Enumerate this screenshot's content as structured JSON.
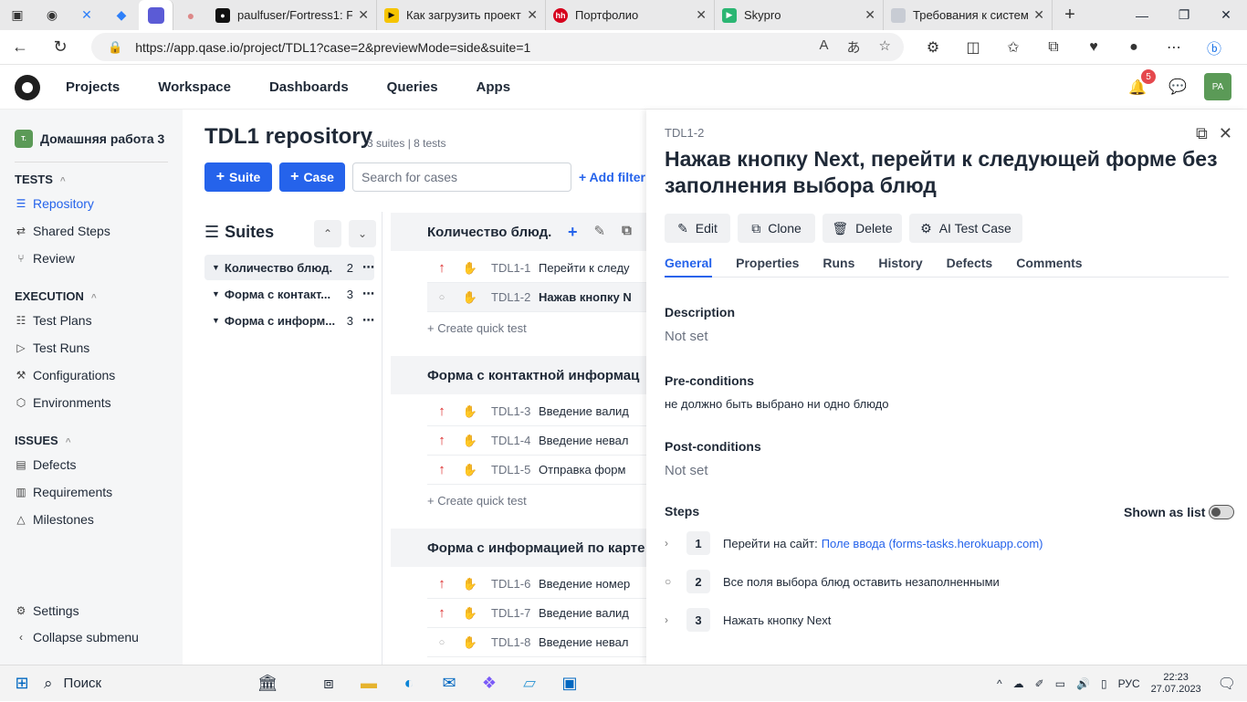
{
  "browser": {
    "tabs": [
      {
        "title": "paulfuser/Fortress1: Fo",
        "color": "#111111"
      },
      {
        "title": "Как загрузить проект",
        "color": "#f5c400"
      },
      {
        "title": "Портфолио",
        "color": "#d6001c"
      },
      {
        "title": "Skypro",
        "color": "#2bb673"
      },
      {
        "title": "Требования к систем",
        "color": "#c8ccd4"
      }
    ],
    "url": "https://app.qase.io/project/TDL1?case=2&previewMode=side&suite=1"
  },
  "app": {
    "nav": [
      "Projects",
      "Workspace",
      "Dashboards",
      "Queries",
      "Apps"
    ],
    "notifications": "5",
    "avatar": "PA"
  },
  "sidebar": {
    "project": "Домашняя работа 3",
    "sections": [
      {
        "title": "TESTS",
        "items": [
          "Repository",
          "Shared Steps",
          "Review"
        ]
      },
      {
        "title": "EXECUTION",
        "items": [
          "Test Plans",
          "Test Runs",
          "Configurations",
          "Environments"
        ]
      },
      {
        "title": "ISSUES",
        "items": [
          "Defects",
          "Requirements",
          "Milestones"
        ]
      }
    ],
    "settings": "Settings",
    "collapse": "Collapse submenu"
  },
  "repo": {
    "title": "TDL1 repository",
    "subtitle": "3 suites | 8 tests",
    "suite_btn": "Suite",
    "case_btn": "Case",
    "search_placeholder": "Search for cases",
    "add_filter": "+ Add filter",
    "suites_heading": "Suites",
    "tree": [
      {
        "name": "Количество блюд.",
        "count": "2"
      },
      {
        "name": "Форма с контакт...",
        "count": "3"
      },
      {
        "name": "Форма с информ...",
        "count": "3"
      }
    ],
    "suites": [
      {
        "title": "Количество блюд.",
        "cases": [
          {
            "id": "TDL1-1",
            "name": "Перейти к следу",
            "priority": "high"
          },
          {
            "id": "TDL1-2",
            "name": "Нажав кнопку N",
            "priority": "none"
          }
        ]
      },
      {
        "title": "Форма с контактной информац",
        "cases": [
          {
            "id": "TDL1-3",
            "name": "Введение валид",
            "priority": "high"
          },
          {
            "id": "TDL1-4",
            "name": "Введение невал",
            "priority": "high"
          },
          {
            "id": "TDL1-5",
            "name": "Отправка форм",
            "priority": "high"
          }
        ]
      },
      {
        "title": "Форма с информацией по карте",
        "cases": [
          {
            "id": "TDL1-6",
            "name": "Введение номер",
            "priority": "high"
          },
          {
            "id": "TDL1-7",
            "name": "Введение валид",
            "priority": "high"
          },
          {
            "id": "TDL1-8",
            "name": "Введение невал",
            "priority": "none"
          }
        ]
      }
    ],
    "quick_test": "+ Create quick test"
  },
  "detail": {
    "id": "TDL1-2",
    "title": "Нажав кнопку Next, перейти к следующей форме без заполнения выбора блюд",
    "buttons": [
      "Edit",
      "Clone",
      "Delete",
      "AI Test Case"
    ],
    "tabs": [
      "General",
      "Properties",
      "Runs",
      "History",
      "Defects",
      "Comments"
    ],
    "description_label": "Description",
    "description": "Not set",
    "pre_label": "Pre-conditions",
    "pre": "не должно быть выбрано ни одно блюдо",
    "post_label": "Post-conditions",
    "post": "Not set",
    "steps_label": "Steps",
    "shown_as_list": "Shown as list",
    "steps": [
      {
        "num": "1",
        "text": "Перейти на сайт:",
        "link": "Поле ввода (forms-tasks.herokuapp.com)"
      },
      {
        "num": "2",
        "text": "Все поля выбора блюд оставить незаполненными",
        "link": ""
      },
      {
        "num": "3",
        "text": "Нажать кнопку Next",
        "link": ""
      }
    ]
  },
  "taskbar": {
    "search": "Поиск",
    "lang": "РУС",
    "time": "22:23",
    "date": "27.07.2023"
  }
}
